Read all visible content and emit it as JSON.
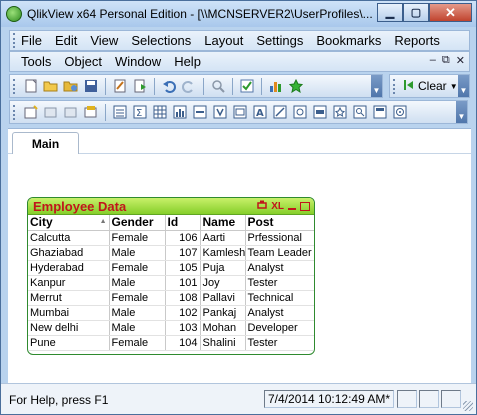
{
  "window": {
    "title": "QlikView x64 Personal Edition - [\\\\MCNSERVER2\\UserProfiles\\..."
  },
  "menu": {
    "row1": [
      "File",
      "Edit",
      "View",
      "Selections",
      "Layout",
      "Settings",
      "Bookmarks",
      "Reports"
    ],
    "row2": [
      "Tools",
      "Object",
      "Window",
      "Help"
    ]
  },
  "toolbar": {
    "clear_label": "Clear"
  },
  "tabs": [
    {
      "label": "Main"
    }
  ],
  "table_box": {
    "title": "Employee Data",
    "xl_label": "XL",
    "columns": [
      "City",
      "Gender",
      "Id",
      "Name",
      "Post"
    ],
    "rows": [
      [
        "Calcutta",
        "Female",
        "106",
        "Aarti",
        "Prfessional"
      ],
      [
        "Ghaziabad",
        "Male",
        "107",
        "Kamlesh",
        "Team Leader"
      ],
      [
        "Hyderabad",
        "Female",
        "105",
        "Puja",
        "Analyst"
      ],
      [
        "Kanpur",
        "Male",
        "101",
        "Joy",
        "Tester"
      ],
      [
        "Merrut",
        "Female",
        "108",
        "Pallavi",
        "Technical"
      ],
      [
        "Mumbai",
        "Male",
        "102",
        "Pankaj",
        "Analyst"
      ],
      [
        "New delhi",
        "Male",
        "103",
        "Mohan",
        "Developer"
      ],
      [
        "Pune",
        "Female",
        "104",
        "Shalini",
        "Tester"
      ]
    ]
  },
  "status": {
    "help_text": "For Help, press F1",
    "timestamp": "7/4/2014 10:12:49 AM*"
  }
}
